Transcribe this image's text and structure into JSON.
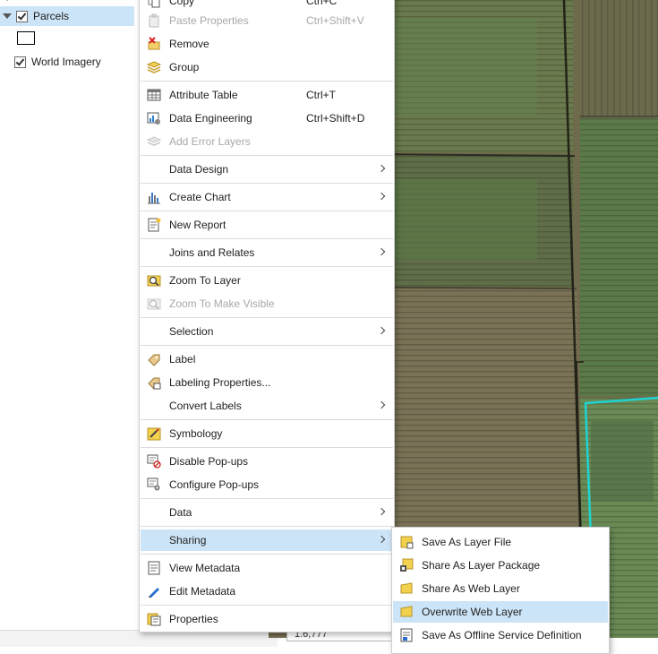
{
  "contents": {
    "layers": [
      {
        "name": "Parcels",
        "checked": true,
        "selected": true
      },
      {
        "name": "World Imagery",
        "checked": true,
        "selected": false
      }
    ],
    "scale_value": "1:6,777"
  },
  "context_menu": {
    "items": [
      {
        "label": "Copy",
        "shortcut": "Ctrl+C",
        "icon": "copy-icon",
        "enabled": true
      },
      {
        "label": "Paste Properties",
        "shortcut": "Ctrl+Shift+V",
        "icon": "paste-icon",
        "enabled": false
      },
      {
        "label": "Remove",
        "shortcut": "",
        "icon": "remove-icon",
        "enabled": true
      },
      {
        "label": "Group",
        "shortcut": "",
        "icon": "group-icon",
        "enabled": true
      },
      {
        "label": "Attribute Table",
        "shortcut": "Ctrl+T",
        "icon": "table-icon",
        "enabled": true
      },
      {
        "label": "Data Engineering",
        "shortcut": "Ctrl+Shift+D",
        "icon": "data-engineering-icon",
        "enabled": true
      },
      {
        "label": "Add Error Layers",
        "shortcut": "",
        "icon": "error-layers-icon",
        "enabled": false
      },
      {
        "label": "Data Design",
        "submenu": true,
        "enabled": true
      },
      {
        "label": "Create Chart",
        "submenu": true,
        "icon": "chart-icon",
        "enabled": true
      },
      {
        "label": "New Report",
        "icon": "report-icon",
        "enabled": true
      },
      {
        "label": "Joins and Relates",
        "submenu": true,
        "enabled": true
      },
      {
        "label": "Zoom To Layer",
        "icon": "zoom-layer-icon",
        "enabled": true
      },
      {
        "label": "Zoom To Make Visible",
        "icon": "zoom-visible-icon",
        "enabled": false
      },
      {
        "label": "Selection",
        "submenu": true,
        "enabled": true
      },
      {
        "label": "Label",
        "icon": "label-icon",
        "enabled": true
      },
      {
        "label": "Labeling Properties...",
        "icon": "labeling-properties-icon",
        "enabled": true
      },
      {
        "label": "Convert Labels",
        "submenu": true,
        "enabled": true
      },
      {
        "label": "Symbology",
        "icon": "symbology-icon",
        "enabled": true
      },
      {
        "label": "Disable Pop-ups",
        "icon": "disable-popups-icon",
        "enabled": true
      },
      {
        "label": "Configure Pop-ups",
        "icon": "configure-popups-icon",
        "enabled": true
      },
      {
        "label": "Data",
        "submenu": true,
        "enabled": true
      },
      {
        "label": "Sharing",
        "submenu": true,
        "enabled": true,
        "highlighted": true
      },
      {
        "label": "View Metadata",
        "icon": "view-metadata-icon",
        "enabled": true
      },
      {
        "label": "Edit Metadata",
        "icon": "edit-metadata-icon",
        "enabled": true
      },
      {
        "label": "Properties",
        "icon": "properties-icon",
        "enabled": true
      }
    ]
  },
  "sharing_submenu": {
    "items": [
      {
        "label": "Save As Layer File",
        "icon": "layer-file-icon"
      },
      {
        "label": "Share As Layer Package",
        "icon": "layer-package-icon"
      },
      {
        "label": "Share As Web Layer",
        "icon": "web-layer-icon"
      },
      {
        "label": "Overwrite Web Layer",
        "icon": "overwrite-web-layer-icon",
        "highlighted": true
      },
      {
        "label": "Save As Offline Service Definition",
        "icon": "offline-definition-icon"
      }
    ]
  },
  "colors": {
    "highlight": "#cce4f7",
    "parcel_outline": "#1fd3d3",
    "menu_border": "#cfcfcf"
  }
}
